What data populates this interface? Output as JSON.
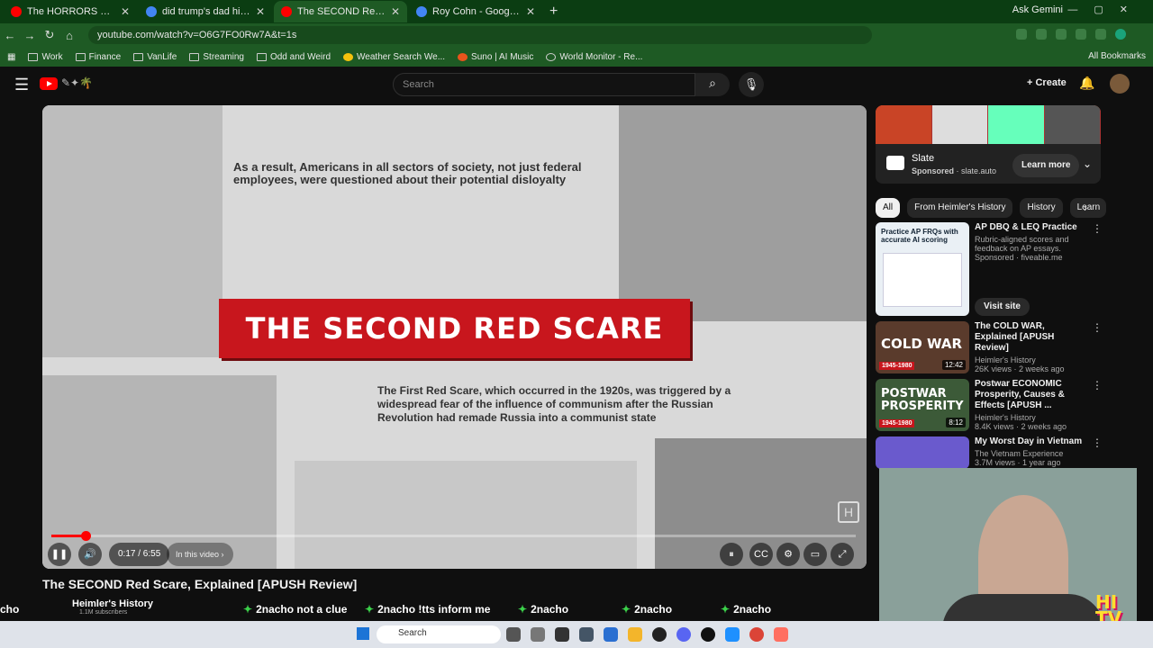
{
  "browser": {
    "tabs": [
      {
        "title": "The HORRORS of Being a Navy",
        "active": false,
        "favicon_color": "#ff0000"
      },
      {
        "title": "did trump's dad hire mccarthy",
        "active": false,
        "favicon_color": "#4285f4"
      },
      {
        "title": "The SECOND Red Scare, Exp",
        "active": true,
        "favicon_color": "#ff0000"
      },
      {
        "title": "Roy Cohn - Google Search",
        "active": false,
        "favicon_color": "#4285f4"
      }
    ],
    "gemini_label": "Ask Gemini",
    "url": "youtube.com/watch?v=O6G7FO0Rw7A&t=1s",
    "bookmarks": [
      "Work",
      "Finance",
      "VanLife",
      "Streaming",
      "Odd and Weird",
      "Weather Search We...",
      "Suno | AI Music",
      "World Monitor - Re..."
    ],
    "all_bookmarks_label": "All Bookmarks"
  },
  "youtube": {
    "search_placeholder": "Search",
    "create_label": "Create"
  },
  "player": {
    "quote_top": "As a result, Americans in all sectors of society, not just federal employees, were questioned about their potential disloyalty",
    "banner_title": "THE SECOND RED SCARE",
    "quote_bottom": "The First Red Scare, which occurred in the 1920s, was triggered by a widespread fear of the influence of communism after the Russian Revolution had remade Russia into a communist state",
    "watermark": "H",
    "time_display": "0:17 / 6:55",
    "chapter_label": "In this video",
    "progress_fraction": 0.043
  },
  "video_title": "The SECOND Red Scare, Explained [APUSH Review]",
  "channel": {
    "name": "Heimler's History",
    "subscribers": "1.1M subscribers"
  },
  "chat_overlay": [
    {
      "user": "2nacho",
      "text": "not a clue"
    },
    {
      "user": "2nacho",
      "text": "!tts inform me"
    },
    {
      "user": "2nacho",
      "text": ""
    },
    {
      "user": "2nacho",
      "text": ""
    },
    {
      "user": "2nacho",
      "text": ""
    }
  ],
  "ad": {
    "brand": "Slate",
    "sponsored": "Sponsored",
    "domain": "slate.auto",
    "cta": "Learn more"
  },
  "chips": [
    "All",
    "From Heimler's History",
    "History",
    "Learn"
  ],
  "recommendations": [
    {
      "title": "AP DBQ & LEQ Practice",
      "channel": "Rubric-aligned scores and feedback on AP essays.",
      "meta": "Sponsored · fiveable.me",
      "thumb_text": "Practice AP FRQs with accurate AI scoring",
      "cta": "Visit site"
    },
    {
      "title": "The COLD WAR, Explained [APUSH Review]",
      "channel": "Heimler's History",
      "meta": "26K views · 2 weeks ago",
      "thumb_text": "COLD WAR",
      "duration": "12:42",
      "tag": "1945-1980"
    },
    {
      "title": "Postwar ECONOMIC Prosperity, Causes & Effects [APUSH ...",
      "channel": "Heimler's History",
      "meta": "8.4K views · 2 weeks ago",
      "thumb_text": "POSTWAR PROSPERITY",
      "duration": "8:12",
      "tag": "1945-1980"
    },
    {
      "title": "My Worst Day in Vietnam",
      "channel": "The Vietnam Experience",
      "meta": "3.7M views · 1 year ago"
    }
  ],
  "webcam_logo": "HI TV",
  "taskbar": {
    "search_label": "Search"
  }
}
